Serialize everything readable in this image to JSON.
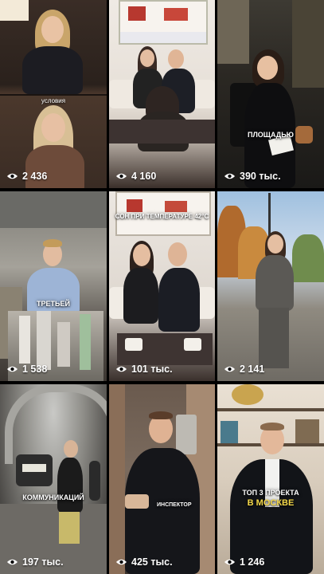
{
  "grid": {
    "tiles": [
      {
        "views": "2 436",
        "overlay_top": "условия",
        "caption": ""
      },
      {
        "views": "4 160",
        "caption": ""
      },
      {
        "views": "390 тыс.",
        "caption": "площадью"
      },
      {
        "views": "1 538",
        "caption": "третьей"
      },
      {
        "views": "101 тыс.",
        "caption": "сон при температуре 42°C"
      },
      {
        "views": "2 141",
        "caption": ""
      },
      {
        "views": "197 тыс.",
        "caption": "коммуникаций"
      },
      {
        "views": "425 тыс.",
        "caption": "инспектор"
      },
      {
        "views": "1 246",
        "caption": "топ 3 проекта",
        "caption_accent": "в москве"
      }
    ]
  },
  "icons": {
    "views": "eye-icon"
  }
}
